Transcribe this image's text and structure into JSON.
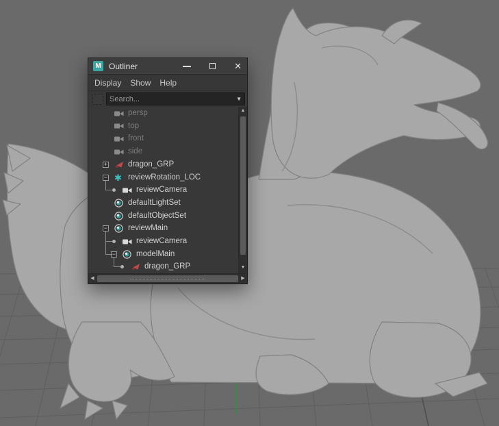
{
  "window": {
    "title": "Outliner",
    "menu_items": [
      "Display",
      "Show",
      "Help"
    ],
    "search_placeholder": "Search..."
  },
  "tree": {
    "items": [
      {
        "label": "persp",
        "icon": "camera",
        "dimmed": true,
        "depth": 0,
        "marker": "none"
      },
      {
        "label": "top",
        "icon": "camera",
        "dimmed": true,
        "depth": 0,
        "marker": "none"
      },
      {
        "label": "front",
        "icon": "camera",
        "dimmed": true,
        "depth": 0,
        "marker": "none"
      },
      {
        "label": "side",
        "icon": "camera",
        "dimmed": true,
        "depth": 0,
        "marker": "none"
      },
      {
        "label": "dragon_GRP",
        "icon": "transform",
        "dimmed": false,
        "depth": 0,
        "marker": "plus"
      },
      {
        "label": "reviewRotation_LOC",
        "icon": "locator",
        "dimmed": false,
        "depth": 0,
        "marker": "minus"
      },
      {
        "label": "reviewCamera",
        "icon": "camera",
        "dimmed": false,
        "depth": 1,
        "marker": "bullet"
      },
      {
        "label": "defaultLightSet",
        "icon": "set",
        "dimmed": false,
        "depth": 0,
        "marker": "none"
      },
      {
        "label": "defaultObjectSet",
        "icon": "set",
        "dimmed": false,
        "depth": 0,
        "marker": "none"
      },
      {
        "label": "reviewMain",
        "icon": "set",
        "dimmed": false,
        "depth": 0,
        "marker": "minus"
      },
      {
        "label": "reviewCamera",
        "icon": "camera",
        "dimmed": false,
        "depth": 1,
        "marker": "bullet"
      },
      {
        "label": "modelMain",
        "icon": "set",
        "dimmed": false,
        "depth": 1,
        "marker": "minus"
      },
      {
        "label": "dragon_GRP",
        "icon": "transform",
        "dimmed": false,
        "depth": 2,
        "marker": "bullet"
      }
    ],
    "connectors": [
      {
        "parent_row": 5,
        "child_rows": [
          6
        ]
      },
      {
        "parent_row": 9,
        "child_rows": [
          10,
          11
        ]
      },
      {
        "parent_row": 11,
        "child_rows": [
          12
        ]
      }
    ]
  },
  "colors": {
    "maya_teal": "#3aa7a0",
    "locator_icon": "#3fc0c0",
    "transform_icon": "#c0494b",
    "set_icon_teal": "#2f9e9e",
    "selection_green": "#2f8f44",
    "viewport_bg": "#6a6a6a",
    "panel_bg": "#373737"
  }
}
